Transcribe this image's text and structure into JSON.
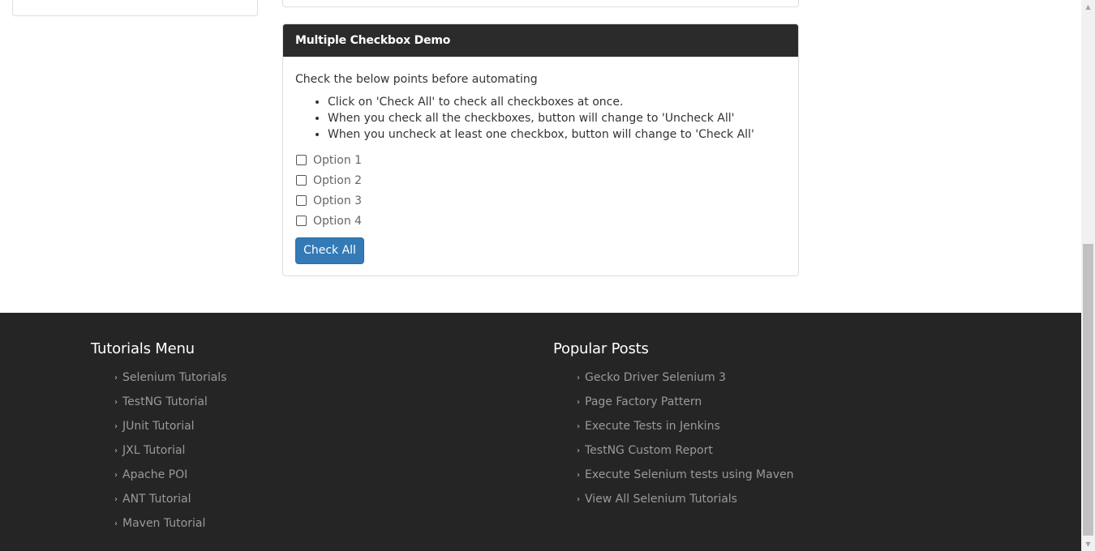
{
  "panel": {
    "title": "Multiple Checkbox Demo",
    "intro": "Check the below points before automating",
    "rules": [
      "Click on 'Check All' to check all checkboxes at once.",
      "When you check all the checkboxes, button will change to 'Uncheck All'",
      "When you uncheck at least one checkbox, button will change to 'Check All'"
    ],
    "options": [
      "Option 1",
      "Option 2",
      "Option 3",
      "Option 4"
    ],
    "button_label": "Check All"
  },
  "footer": {
    "tutorials": {
      "title": "Tutorials Menu",
      "items": [
        "Selenium Tutorials",
        "TestNG Tutorial",
        "JUnit Tutorial",
        "JXL Tutorial",
        "Apache POI",
        "ANT Tutorial",
        "Maven Tutorial"
      ]
    },
    "popular": {
      "title": "Popular Posts",
      "items": [
        "Gecko Driver Selenium 3",
        "Page Factory Pattern",
        "Execute Tests in Jenkins",
        "TestNG Custom Report",
        "Execute Selenium tests using Maven",
        "View All Selenium Tutorials"
      ]
    }
  },
  "icons": {
    "chevron": "chevron-right-icon",
    "scroll_up": "scroll-up-arrow-icon",
    "scroll_down": "scroll-down-arrow-icon"
  },
  "colors": {
    "panel_heading_bg": "#2b2b2b",
    "button_bg": "#337ab7",
    "footer_bg": "#252525",
    "footer_link": "#9a9a9a"
  }
}
